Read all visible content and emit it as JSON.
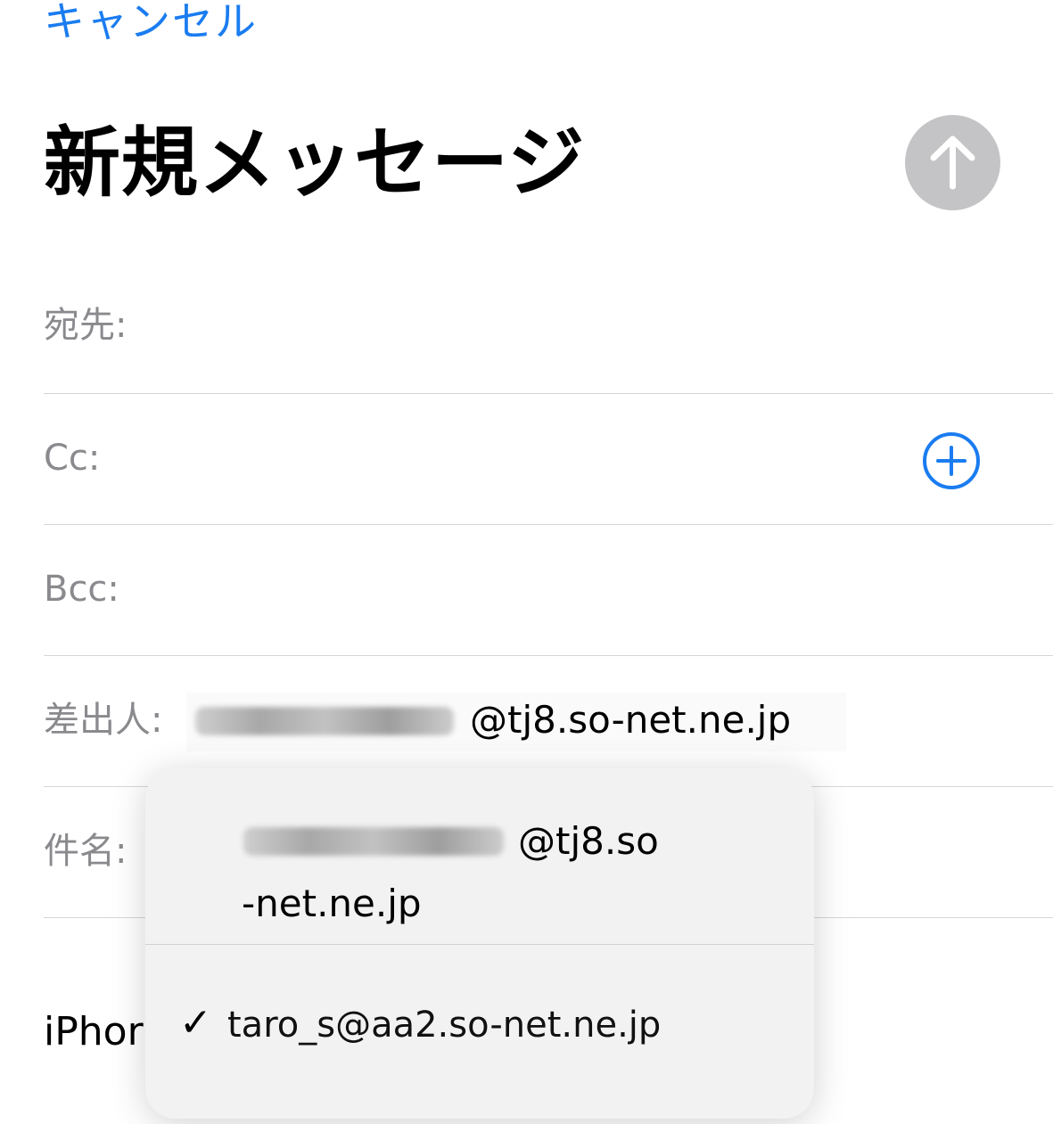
{
  "header": {
    "cancel_label": "キャンセル",
    "title": "新規メッセージ",
    "send_icon": "arrow-up-icon"
  },
  "fields": {
    "to_label": "宛先:",
    "cc_label": "Cc:",
    "bcc_label": "Bcc:",
    "from_label": "差出人:",
    "from_domain": "@tj8.so-net.ne.jp",
    "subject_label": "件名:",
    "add_icon": "plus-circle-icon"
  },
  "body": {
    "signature_visible": "iPhor"
  },
  "sender_menu": {
    "option_1_line1_domain": "@tj8.so",
    "option_1_line2": "-net.ne.jp",
    "option_2_check": "✓",
    "option_2_address": "taro_s@aa2.so-net.ne.jp"
  },
  "colors": {
    "accent": "#1a7cf0",
    "send_disabled": "#c4c4c6",
    "label_gray": "#8a8a8e"
  }
}
